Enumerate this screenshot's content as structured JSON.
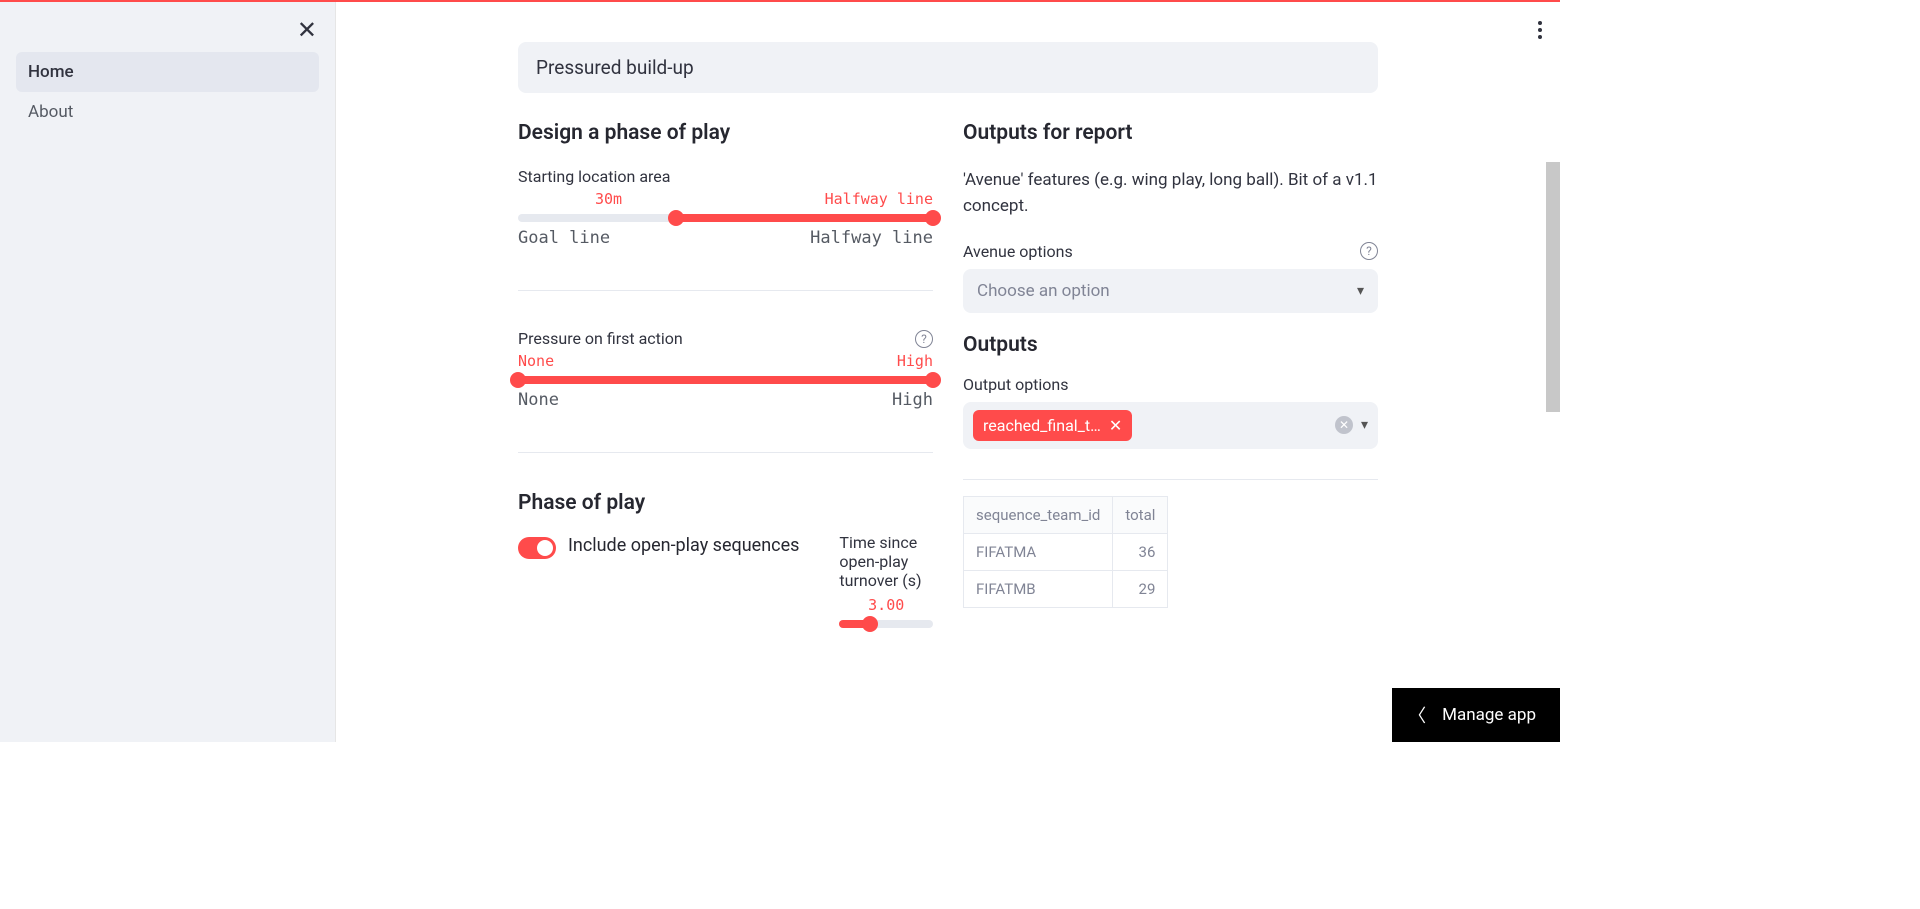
{
  "sidebar": {
    "items": [
      {
        "label": "Home",
        "active": true
      },
      {
        "label": "About",
        "active": false
      }
    ]
  },
  "header_card": "Pressured build-up",
  "left": {
    "heading": "Design a phase of play",
    "start_loc": {
      "label": "Starting location area",
      "val_low": "30m",
      "val_high": "Halfway line",
      "end_low": "Goal line",
      "end_high": "Halfway line"
    },
    "pressure": {
      "label": "Pressure on first action",
      "val_low": "None",
      "val_high": "High",
      "end_low": "None",
      "end_high": "High"
    },
    "phase_heading": "Phase of play",
    "toggle": {
      "label": "Include open-play sequences",
      "checked": true
    },
    "turnover": {
      "label": "Time since open-play turnover (s)",
      "value": "3.00"
    }
  },
  "right": {
    "heading": "Outputs for report",
    "desc": "'Avenue' features (e.g. wing play, long ball). Bit of a v1.1 concept.",
    "avenue": {
      "label": "Avenue options",
      "placeholder": "Choose an option"
    },
    "outputs_heading": "Outputs",
    "output_options": {
      "label": "Output options",
      "tag": "reached_final_t…"
    },
    "table": {
      "cols": [
        "sequence_team_id",
        "total"
      ],
      "rows": [
        {
          "team": "FIFATMA",
          "total": "36"
        },
        {
          "team": "FIFATMB",
          "total": "29"
        }
      ]
    }
  },
  "manage": "Manage app"
}
